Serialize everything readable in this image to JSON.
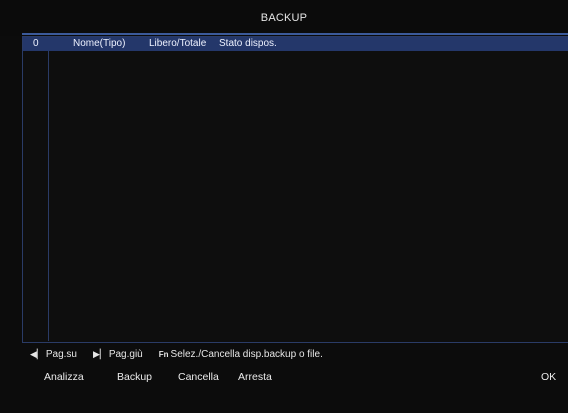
{
  "window": {
    "title": "BACKUP"
  },
  "table": {
    "columns": [
      "0",
      "Nome(Tipo)",
      "Libero/Totale",
      "Stato dispos."
    ],
    "rows": []
  },
  "hints": [
    {
      "icon": "prev-page-icon",
      "label": "Pag.su"
    },
    {
      "icon": "next-page-icon",
      "label": "Pag.giù"
    },
    {
      "icon": "fn-key-icon",
      "label": "Selez./Cancella disp.backup o file."
    }
  ],
  "actions": {
    "analizza": "Analizza",
    "backup": "Backup",
    "cancella": "Cancella",
    "arresta": "Arresta",
    "ok": "OK"
  },
  "colors": {
    "background": "#0c0c0c",
    "header": "#24376a",
    "accent_line": "#3b5a9a"
  }
}
